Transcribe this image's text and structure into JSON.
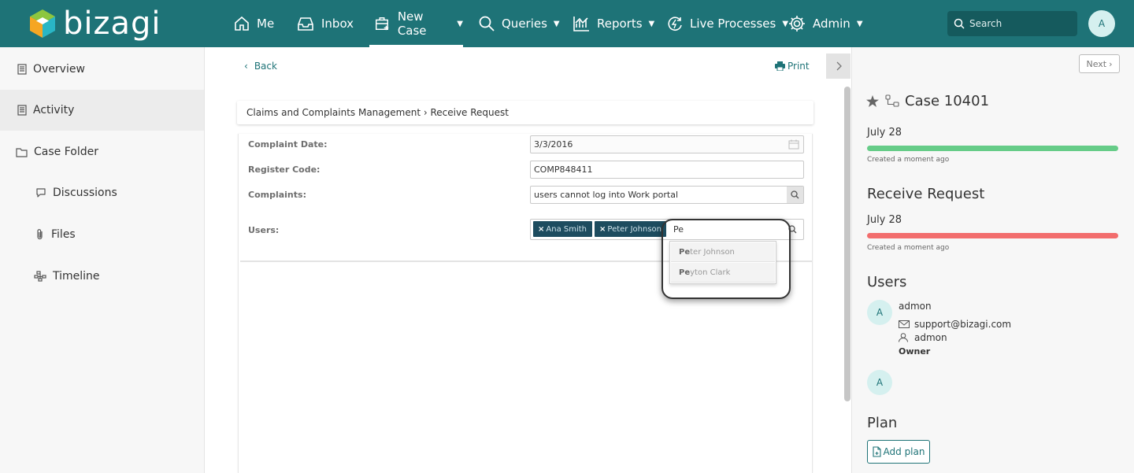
{
  "app": {
    "logo_text": "bizagi"
  },
  "nav": {
    "items": [
      {
        "label": "Me",
        "icon": "home-icon"
      },
      {
        "label": "Inbox",
        "icon": "inbox-icon"
      },
      {
        "label": "New Case",
        "icon": "new-case-icon",
        "active": true
      },
      {
        "label": "Queries",
        "icon": "search-icon"
      },
      {
        "label": "Reports",
        "icon": "chart-icon"
      },
      {
        "label": "Live Processes",
        "icon": "live-processes-icon"
      },
      {
        "label": "Admin",
        "icon": "gear-icon"
      }
    ],
    "search_placeholder": "Search",
    "avatar_initial": "A"
  },
  "sidebar": {
    "items": [
      {
        "label": "Overview",
        "icon": "document-icon"
      },
      {
        "label": "Activity",
        "icon": "document-icon",
        "active": true
      },
      {
        "label": "Case Folder",
        "icon": "folder-icon"
      },
      {
        "label": "Discussions",
        "icon": "chat-icon"
      },
      {
        "label": "Files",
        "icon": "paperclip-icon"
      },
      {
        "label": "Timeline",
        "icon": "timeline-icon"
      }
    ]
  },
  "main": {
    "back_label": "Back",
    "print_label": "Print",
    "breadcrumb": "Claims and Complaints Management › Receive Request",
    "form": {
      "complaint_date_label": "Complaint Date:",
      "complaint_date_value": "3/3/2016",
      "register_code_label": "Register Code:",
      "register_code_value": "COMP848411",
      "complaints_label": "Complaints:",
      "complaints_value": "users cannot log into Work portal",
      "users_label": "Users:",
      "users_chips": [
        "Ana Smith",
        "Peter Johnson"
      ],
      "chip_remove_glyph": "×",
      "users_typed": "Pe",
      "suggestions": [
        {
          "match": "Pe",
          "rest": "ter Johnson"
        },
        {
          "match": "Pe",
          "rest": "yton Clark"
        }
      ]
    }
  },
  "right_panel": {
    "next_label": "Next",
    "case_title": "Case 10401",
    "timeline": [
      {
        "date": "July 28",
        "note": "Created a moment ago",
        "bar_color": "#66cc88"
      },
      {
        "date": "July 28",
        "note": "Created a moment ago",
        "bar_color": "#f26d6d"
      }
    ],
    "activity_title": "Receive Request",
    "users_heading": "Users",
    "user": {
      "avatar_initial": "A",
      "name": "admon",
      "email": "support@bizagi.com",
      "username": "admon",
      "role": "Owner"
    },
    "second_avatar_initial": "A",
    "plan_heading": "Plan",
    "add_plan_label": "Add plan"
  },
  "colors": {
    "topbar": "#1e7377",
    "accent": "#1e7377",
    "chip": "#1d4c5f",
    "progress_green": "#66cc88",
    "progress_red": "#f26d6d"
  }
}
